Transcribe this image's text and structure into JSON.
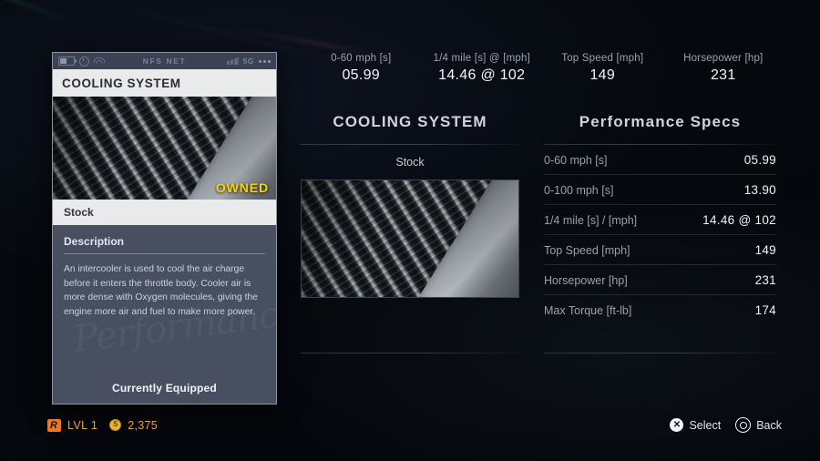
{
  "top_stats": [
    {
      "label": "0-60 mph [s]",
      "value": "05.99"
    },
    {
      "label": "1/4 mile [s] @ [mph]",
      "value": "14.46 @ 102"
    },
    {
      "label": "Top Speed [mph]",
      "value": "149"
    },
    {
      "label": "Horsepower [hp]",
      "value": "231"
    }
  ],
  "center": {
    "title": "COOLING SYSTEM",
    "variant": "Stock",
    "image_name": "intercooler-core-photo"
  },
  "specs": {
    "title": "Performance Specs",
    "rows": [
      {
        "key": "0-60 mph [s]",
        "value": "05.99"
      },
      {
        "key": "0-100 mph [s]",
        "value": "13.90"
      },
      {
        "key": "1/4 mile [s] / [mph]",
        "value": "14.46 @ 102"
      },
      {
        "key": "Top Speed [mph]",
        "value": "149"
      },
      {
        "key": "Horsepower [hp]",
        "value": "231"
      },
      {
        "key": "Max Torque [ft-lb]",
        "value": "174"
      }
    ]
  },
  "card": {
    "statusbar": {
      "carrier": "NFS NET",
      "network": "5G"
    },
    "title": "COOLING SYSTEM",
    "owned_badge": "OWNED",
    "subtitle": "Stock",
    "description_heading": "Description",
    "description_body": "An intercooler is used to cool the air charge before it enters the throttle body. Cooler air is more dense with Oxygen molecules, giving the engine more air and fuel to make more power.",
    "watermark": "Performance",
    "equipped_label": "Currently Equipped"
  },
  "footer": {
    "rank_badge": "R",
    "level": "LVL 1",
    "currency": "2,375",
    "prompts": [
      {
        "glyph": "✕",
        "label": "Select"
      },
      {
        "glyph": "",
        "label": "Back"
      }
    ]
  },
  "colors": {
    "accent_yellow": "#f5d312",
    "accent_orange": "#e8a33a",
    "card_bg": "#474f60",
    "background": "#05080d"
  }
}
